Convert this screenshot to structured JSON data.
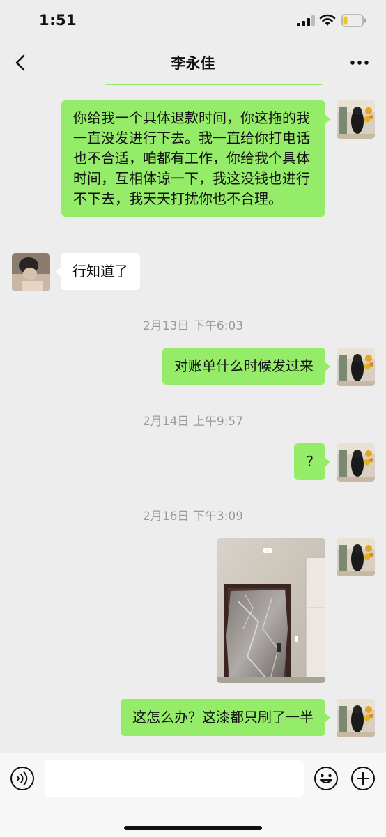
{
  "status_bar": {
    "time": "1:51"
  },
  "header": {
    "title": "李永佳"
  },
  "messages": [
    {
      "sender": "me",
      "text": "你给我一个具体退款时间，你这拖的我一直没发进行下去。我一直给你打电话也不合适，咱都有工作，你给我个具体时间，互相体谅一下，我这没钱也进行不下去，我天天打扰你也不合理。"
    },
    {
      "sender": "other",
      "text": "行知道了"
    },
    {
      "timestamp": "2月13日 下午6:03"
    },
    {
      "sender": "me",
      "text": "对账单什么时候发过来"
    },
    {
      "timestamp": "2月14日 上午9:57"
    },
    {
      "sender": "me",
      "text": "?"
    },
    {
      "timestamp": "2月16日 下午3:09"
    },
    {
      "sender": "me",
      "type": "image",
      "image_content": "photo-of-door-covered-in-plastic"
    },
    {
      "sender": "me",
      "text": "这怎么办？这漆都只刷了一半"
    }
  ],
  "input_bar": {
    "placeholder": "",
    "voice_icon": "voice-icon",
    "emoji_icon": "emoji-icon",
    "add_icon": "plus-icon"
  },
  "colors": {
    "my_bubble": "#95ec69",
    "other_bubble": "#ffffff",
    "chat_background": "#ededed"
  }
}
